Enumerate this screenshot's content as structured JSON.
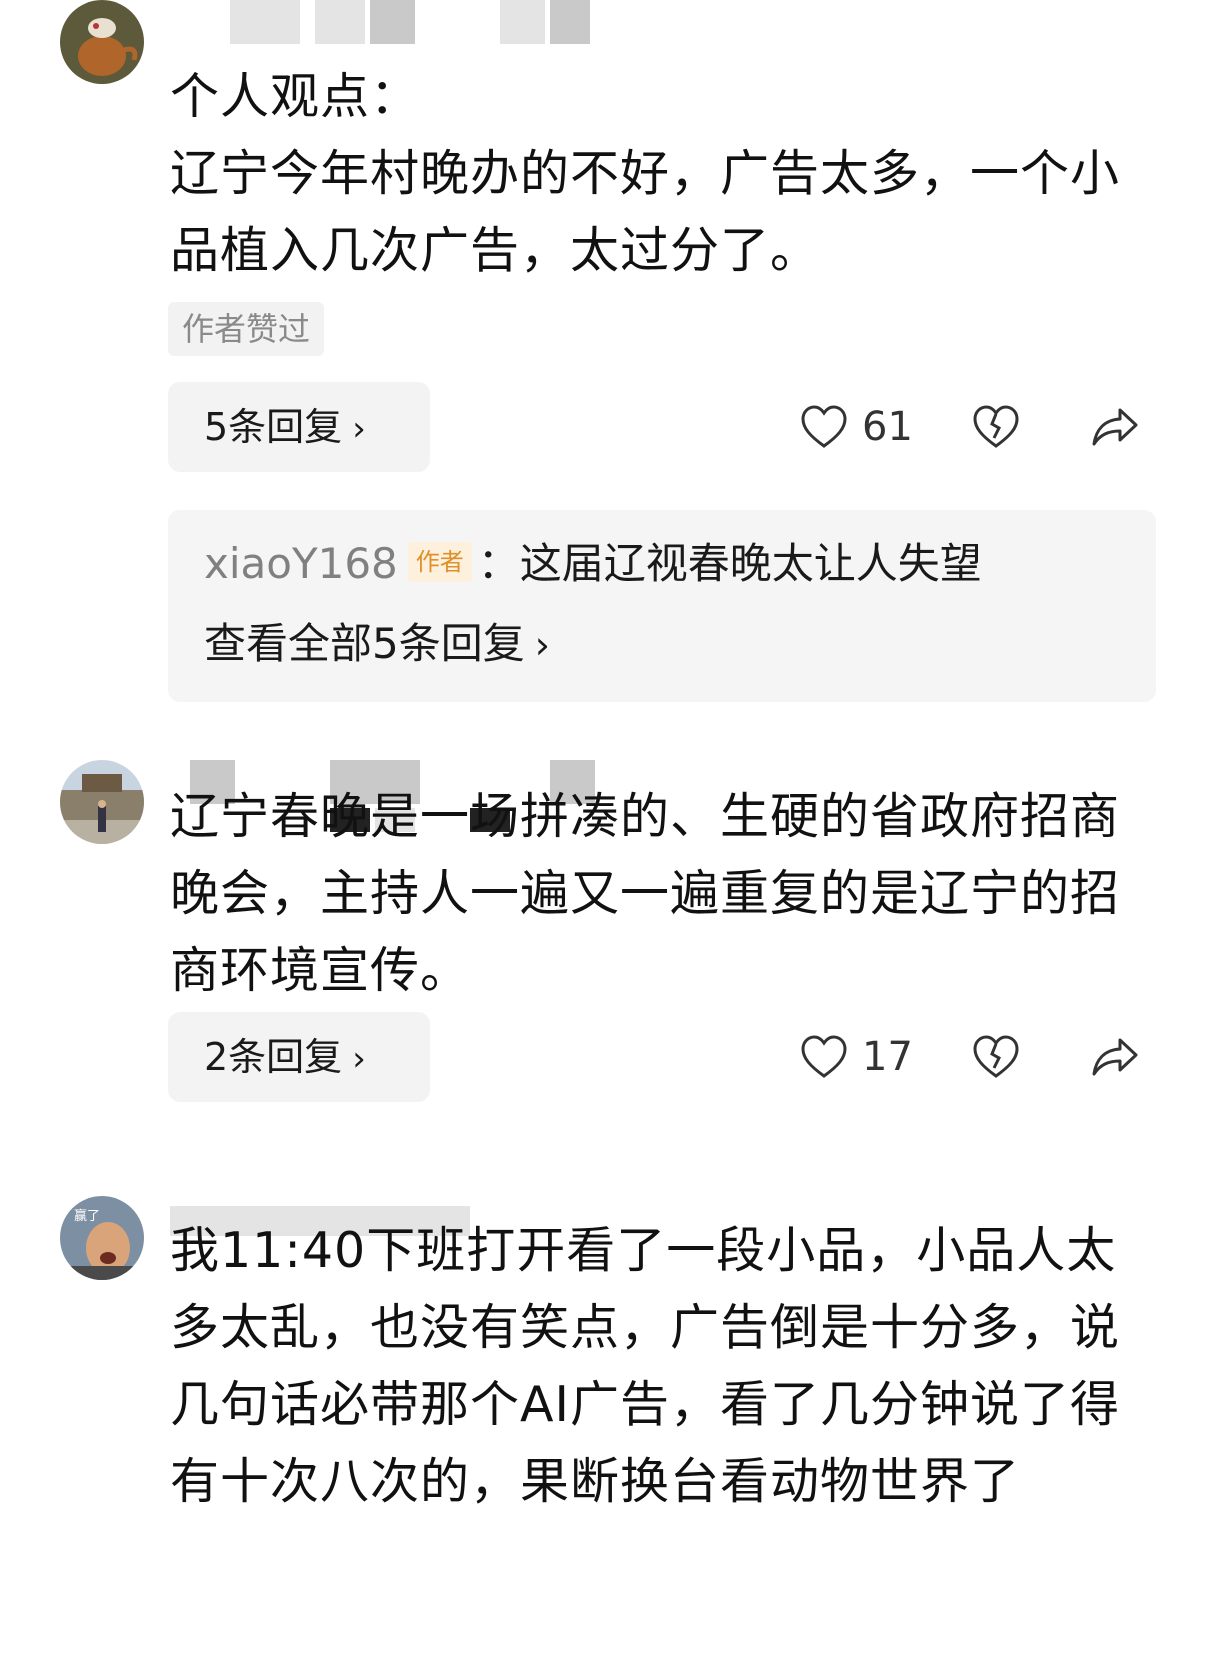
{
  "comments": [
    {
      "username": "",
      "text": "个人观点：\n辽宁今年村晚办的不好，广告太多，一个小品植入几次广告，太过分了。",
      "badge": "作者赞过",
      "reply_button": "5条回复",
      "like_count": "61",
      "reply_preview": {
        "user": "xiaoY168",
        "author_tag": "作者",
        "text": "：这届辽视春晚太让人失望",
        "view_all": "查看全部5条回复"
      }
    },
    {
      "username": "",
      "text": "辽宁春晚是一场拼凑的、生硬的省政府招商晚会，主持人一遍又一遍重复的是辽宁的招商环境宣传。",
      "reply_button": "2条回复",
      "like_count": "17"
    },
    {
      "username": "",
      "text": "我11:40下班打开看了一段小品，小品人太多太乱，也没有笑点，广告倒是十分多，说几句话必带那个AI广告，看了几分钟说了得有十次八次的，果断换台看动物世界了",
      "avatar_text": "赢了"
    }
  ],
  "icons": {
    "like": "heart-outline-icon",
    "dislike": "broken-heart-icon",
    "share": "share-arrow-icon",
    "chevron": "chevron-right-icon"
  },
  "colors": {
    "author_tag_text": "#e0902a",
    "author_tag_bg": "#fdf0dc",
    "muted": "#808080"
  }
}
